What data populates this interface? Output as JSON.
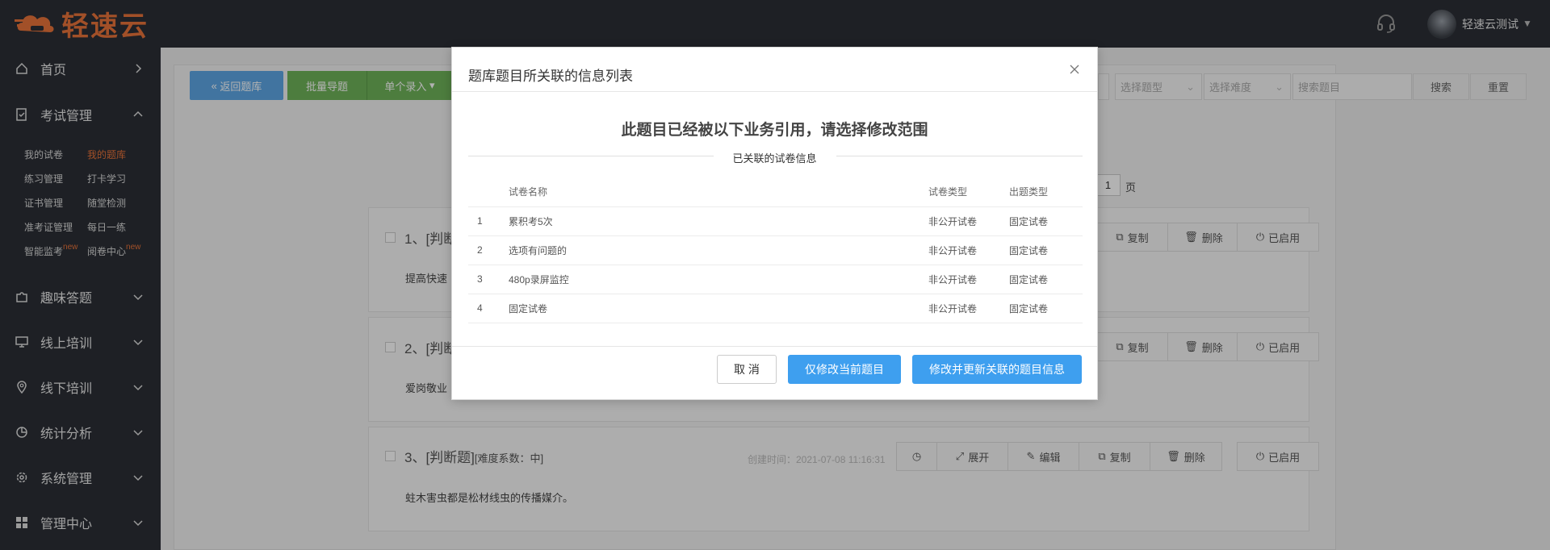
{
  "header": {
    "logo_text": "轻速云",
    "username": "轻速云测试"
  },
  "sidebar": {
    "home": "首页",
    "exam_mgmt": "考试管理",
    "sub_items": {
      "my_papers": "我的试卷",
      "my_bank": "我的题库",
      "practice": "练习管理",
      "checkin": "打卡学习",
      "certificate": "证书管理",
      "quiz": "随堂检测",
      "admission": "准考证管理",
      "daily": "每日一练",
      "proctor": "智能监考",
      "grading": "阅卷中心",
      "new_badge": "new"
    },
    "fun_quiz": "趣味答题",
    "online_training": "线上培训",
    "offline_training": "线下培训",
    "stats": "统计分析",
    "system": "系统管理",
    "admin_center": "管理中心"
  },
  "toolbar": {
    "back": "返回题库",
    "batch_import": "批量导题",
    "single_entry": "单个录入",
    "select_type": "选择题型",
    "select_difficulty": "选择难度",
    "search_placeholder": "搜索题目",
    "search": "搜索",
    "reset": "重置"
  },
  "pager": {
    "page": "1",
    "page_suffix": "页"
  },
  "questions": [
    {
      "title": "1、[判断",
      "body": "提高快速"
    },
    {
      "title": "2、[判断",
      "body": "爱岗敬业"
    },
    {
      "title": "3、[判断题]",
      "difficulty": "[难度系数：中]",
      "created": "创建时间：2021-07-08 11:16:31",
      "body": "蛀木害虫都是松材线虫的传播媒介。"
    }
  ],
  "actions": {
    "expand": "展开",
    "edit": "编辑",
    "copy": "复制",
    "delete": "删除",
    "enabled": "已启用"
  },
  "modal": {
    "title": "题库题目所关联的信息列表",
    "heading": "此题目已经被以下业务引用，请选择修改范围",
    "section_label": "已关联的试卷信息",
    "columns": [
      "试卷名称",
      "试卷类型",
      "出题类型"
    ],
    "rows": [
      {
        "no": "1",
        "name": "累积考5次",
        "paper_type": "非公开试卷",
        "gen_type": "固定试卷"
      },
      {
        "no": "2",
        "name": "选项有问题的",
        "paper_type": "非公开试卷",
        "gen_type": "固定试卷"
      },
      {
        "no": "3",
        "name": "480p录屏监控",
        "paper_type": "非公开试卷",
        "gen_type": "固定试卷"
      },
      {
        "no": "4",
        "name": "固定试卷",
        "paper_type": "非公开试卷",
        "gen_type": "固定试卷"
      }
    ],
    "cancel": "取 消",
    "modify_current": "仅修改当前题目",
    "modify_all": "修改并更新关联的题目信息"
  },
  "colors": {
    "accent": "#e8733a",
    "primary": "#3e9fef",
    "sidebar": "#2b2f36",
    "green": "#6fb35a"
  }
}
